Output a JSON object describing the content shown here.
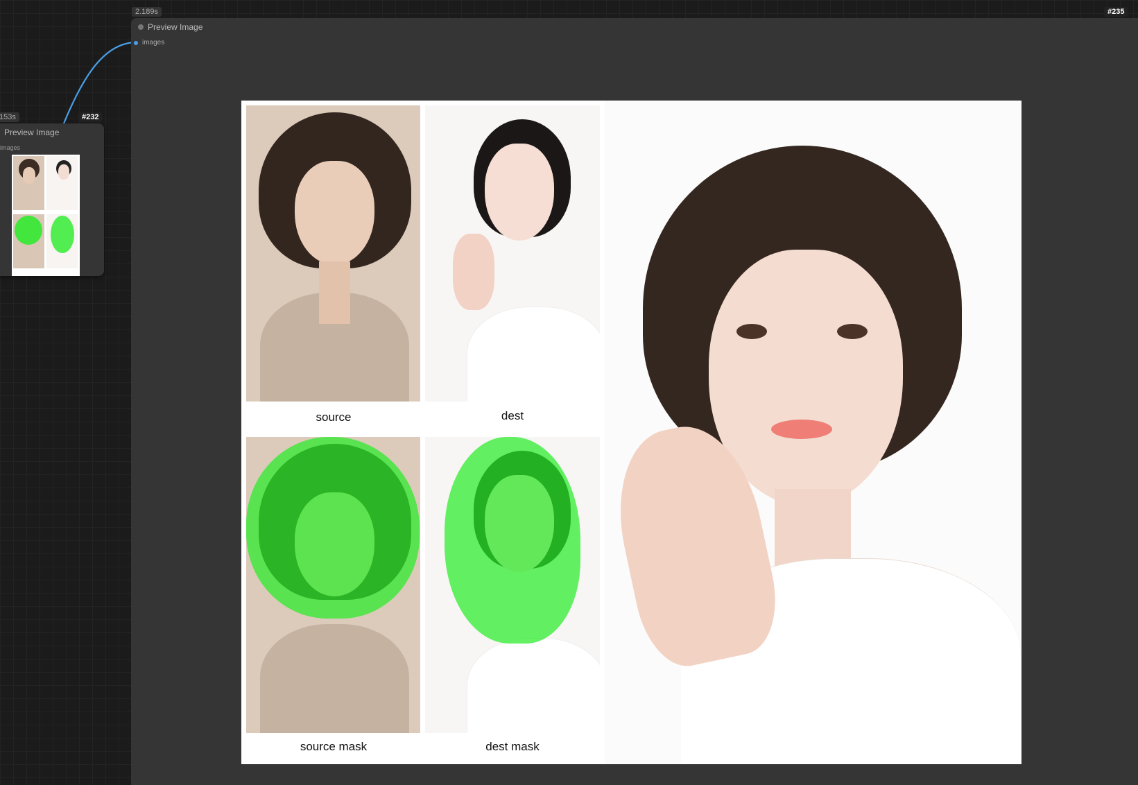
{
  "canvas": {
    "link_color": "#4a9fe8"
  },
  "node_232": {
    "id_label": "#232",
    "timing_label": "153s",
    "title": "Preview Image",
    "input_slot": "images",
    "thumb_captions": [
      "source",
      "dest",
      "source mask",
      "dest mask"
    ]
  },
  "node_235": {
    "id_label": "#235",
    "timing_label": "2.189s",
    "title": "Preview Image",
    "input_slot": "images"
  },
  "preview": {
    "captions": {
      "source": "source",
      "dest": "dest",
      "source_mask": "source mask",
      "dest_mask": "dest mask"
    },
    "mask_color": "#33e633"
  }
}
